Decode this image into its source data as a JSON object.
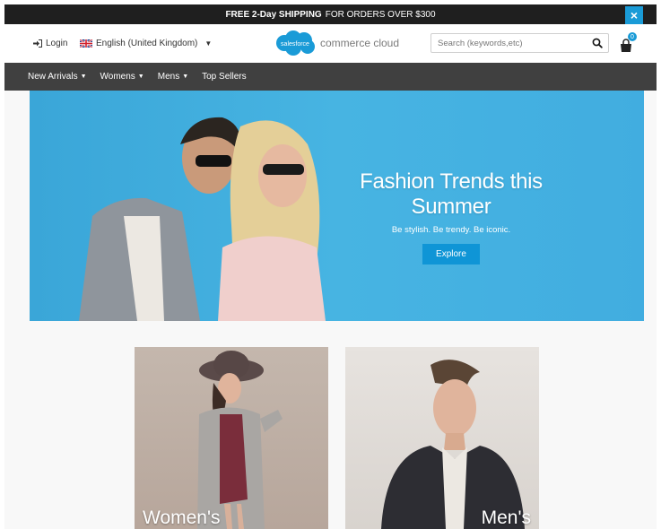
{
  "promo": {
    "bold": "FREE 2-Day SHIPPING",
    "text": "FOR ORDERS OVER $300",
    "close": "×"
  },
  "header": {
    "login": "Login",
    "language": "English (United Kingdom)",
    "logo_badge": "salesforce",
    "logo_text": "commerce cloud",
    "search_placeholder": "Search (keywords,etc)",
    "cart_count": "0"
  },
  "nav": {
    "items": [
      "New Arrivals",
      "Womens",
      "Mens",
      "Top Sellers"
    ]
  },
  "hero": {
    "title": "Fashion Trends this Summer",
    "subtitle": "Be stylish. Be trendy. Be iconic.",
    "button": "Explore"
  },
  "categories": [
    {
      "label": "Women's"
    },
    {
      "label": "Men's"
    }
  ],
  "colors": {
    "accent": "#1a9bd7",
    "nav_bg": "#404040",
    "promo_bg": "#1f1f1f",
    "hero_bg": "#47b4e2"
  }
}
